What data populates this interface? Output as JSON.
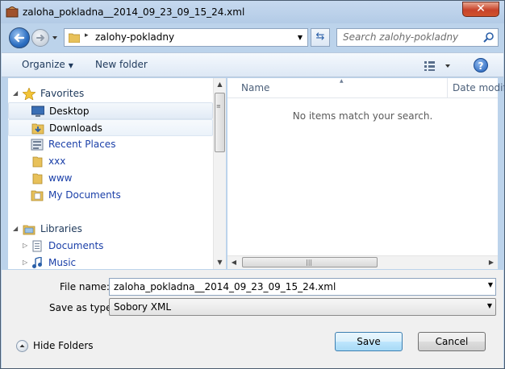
{
  "window": {
    "title": "zaloha_pokladna__2014_09_23_09_15_24.xml",
    "close_label": "✕"
  },
  "address_bar": {
    "path": "zalohy-pokladny",
    "separator": "▸",
    "search_placeholder": "Search zalohy-pokladny"
  },
  "toolbar": {
    "organize_label": "Organize",
    "new_folder_label": "New folder"
  },
  "nav_pane": {
    "favorites_label": "Favorites",
    "favorites": [
      {
        "label": "Desktop",
        "icon": "desktop-icon"
      },
      {
        "label": "Downloads",
        "icon": "downloads-folder-icon"
      },
      {
        "label": "Recent Places",
        "icon": "recent-places-icon"
      },
      {
        "label": "xxx",
        "icon": "folder-icon"
      },
      {
        "label": "www",
        "icon": "folder-icon"
      },
      {
        "label": "My Documents",
        "icon": "documents-folder-icon"
      }
    ],
    "libraries_label": "Libraries",
    "libraries": [
      {
        "label": "Documents",
        "icon": "documents-library-icon"
      },
      {
        "label": "Music",
        "icon": "music-library-icon"
      }
    ]
  },
  "file_list": {
    "columns": [
      "Name",
      "Date modif"
    ],
    "empty_message": "No items match your search."
  },
  "form": {
    "file_name_label": "File name:",
    "file_name_value": "zaloha_pokladna__2014_09_23_09_15_24.xml",
    "save_type_label": "Save as type:",
    "save_type_value": "Sobory XML"
  },
  "footer": {
    "hide_folders_label": "Hide Folders",
    "save_label": "Save",
    "cancel_label": "Cancel"
  },
  "colors": {
    "window_frame": "#bcd3eb",
    "link_text": "#1a3fa8",
    "header_text": "#1e395b"
  }
}
